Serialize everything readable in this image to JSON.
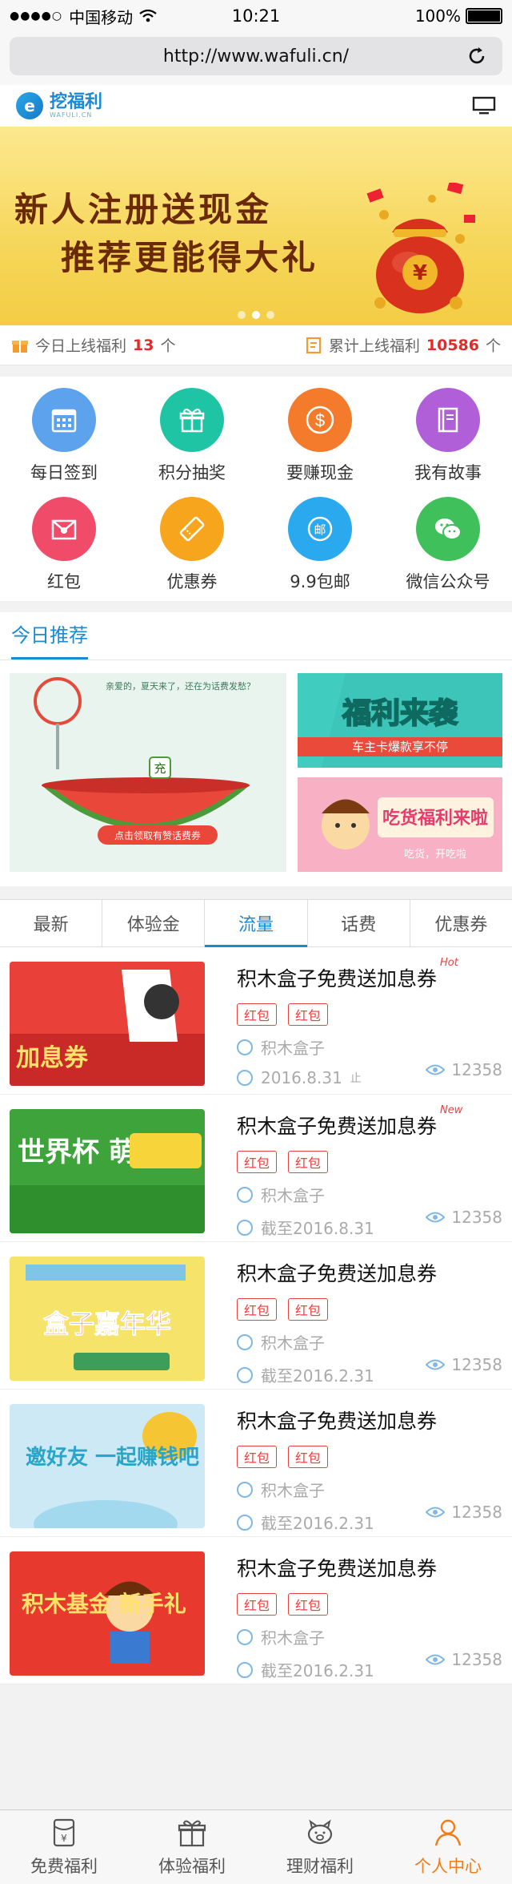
{
  "status": {
    "carrier": "中国移动",
    "time": "10:21",
    "battery": "100%"
  },
  "browser": {
    "url": "http://www.wafuli.cn/"
  },
  "header": {
    "logo_text": "挖福利",
    "logo_sub": "WAFULI.CN"
  },
  "banner": {
    "line1": "新人注册送现金",
    "line2": "推荐更能得大礼",
    "bag_char": "¥"
  },
  "stats": {
    "today_label": "今日上线福利",
    "today_count": "13",
    "today_unit": "个",
    "total_label": "累计上线福利",
    "total_count": "10586",
    "total_unit": "个"
  },
  "grid": [
    {
      "label": "每日签到",
      "color": "#5da2ec",
      "icon": "calendar-icon"
    },
    {
      "label": "积分抽奖",
      "color": "#1ec4a3",
      "icon": "gift-icon"
    },
    {
      "label": "要赚现金",
      "color": "#f47b2b",
      "icon": "dollar-icon"
    },
    {
      "label": "我有故事",
      "color": "#b15fd8",
      "icon": "book-icon"
    },
    {
      "label": "红包",
      "color": "#f14b6a",
      "icon": "envelope-icon"
    },
    {
      "label": "优惠券",
      "color": "#f7a51d",
      "icon": "ticket-icon"
    },
    {
      "label": "9.9包邮",
      "color": "#2aa9ef",
      "icon": "mail-icon"
    },
    {
      "label": "微信公众号",
      "color": "#3fc05a",
      "icon": "wechat-icon"
    }
  ],
  "recommend": {
    "title": "今日推荐",
    "big_btn": "点击领取有赞话费券",
    "big_note": "亲爱的，夏天来了，还在为话费发愁？",
    "big_char": "充",
    "sm1_title": "福利来袭",
    "sm1_sub": "车主卡爆款享不停",
    "sm2_title": "吃货福利来啦",
    "sm2_sub": "吃货，开吃啦"
  },
  "tabs": [
    "最新",
    "体验金",
    "流量",
    "话费",
    "优惠券"
  ],
  "list": [
    {
      "title": "积木盒子免费送加息券",
      "flag": "Hot",
      "tags": [
        "红包",
        "红包"
      ],
      "source": "积木盒子",
      "date": "2016.8.31",
      "date_suffix": "止",
      "views": "12358",
      "thumb_text": "加息券"
    },
    {
      "title": "积木盒子免费送加息券",
      "flag": "New",
      "tags": [
        "红包",
        "红包"
      ],
      "source": "积木盒子",
      "date": "截至2016.8.31",
      "date_suffix": "",
      "views": "12358",
      "thumb_text": "世界杯 萌动"
    },
    {
      "title": "积木盒子免费送加息券",
      "flag": "",
      "tags": [
        "红包",
        "红包"
      ],
      "source": "积木盒子",
      "date": "截至2016.2.31",
      "date_suffix": "",
      "views": "12358",
      "thumb_text": "盒子嘉年华"
    },
    {
      "title": "积木盒子免费送加息券",
      "flag": "",
      "tags": [
        "红包",
        "红包"
      ],
      "source": "积木盒子",
      "date": "截至2016.2.31",
      "date_suffix": "",
      "views": "12358",
      "thumb_text": "邀好友 一起赚钱吧"
    },
    {
      "title": "积木盒子免费送加息券",
      "flag": "",
      "tags": [
        "红包",
        "红包"
      ],
      "source": "积木盒子",
      "date": "截至2016.2.31",
      "date_suffix": "",
      "views": "12358",
      "thumb_text": "积木基金 新手礼"
    }
  ],
  "bottom_nav": [
    {
      "label": "免费福利",
      "icon": "yuan-bag-icon"
    },
    {
      "label": "体验福利",
      "icon": "gift-box-icon"
    },
    {
      "label": "理财福利",
      "icon": "piggy-bank-icon"
    },
    {
      "label": "个人中心",
      "icon": "user-icon",
      "active": true
    }
  ],
  "colors": {
    "accent": "#1a8ad6",
    "hot": "#e02b2b",
    "active_nav": "#f07d1a"
  }
}
